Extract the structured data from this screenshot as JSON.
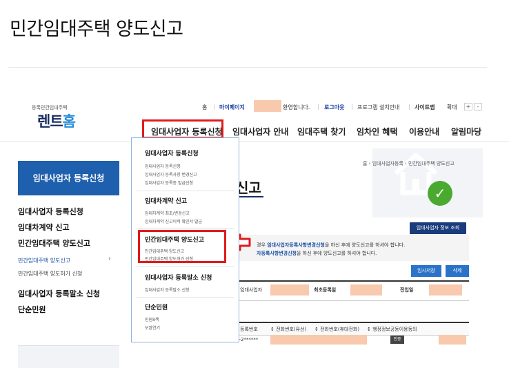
{
  "page": {
    "title": "민간임대주택 양도신고"
  },
  "header": {
    "logo_sub": "등록민간임대주택",
    "logo_main_a": "렌트",
    "logo_main_b": "홈",
    "util": {
      "home": "홈",
      "mypage": "마이페이지",
      "welcome": "환영합니다.",
      "logout": "로그아웃",
      "program": "프로그램 설치안내",
      "sitemap": "사이트맵",
      "zoom_label": "확대",
      "zoom_in": "+",
      "zoom_out": "-"
    },
    "nav": [
      "임대사업자 등록신청",
      "임대사업자 안내",
      "임대주택 찾기",
      "임차인 혜택",
      "이용안내",
      "알림마당"
    ]
  },
  "sidebar": {
    "heading": "임대사업자 등록신청",
    "items": [
      "임대사업자 등록신청",
      "임대차계약 신고",
      "민간임대주택 양도신고",
      "민간임대주택 양도신고",
      "민간임대주택 양도허가 신청",
      "임대사업자 등록말소 신청",
      "단순민원"
    ],
    "arrow": "›"
  },
  "content": {
    "breadcrumb": "홈 › 임대사업자등록 › 민간임대주택 양도신고",
    "title": "신고",
    "owner_info_button": "임대사업자 정보 조회",
    "notice": {
      "line1_a": "경우 ",
      "line1_link": "임대사업자등록사항변경신청",
      "line1_b": "을 하신 후에 양도신고를 하셔야 합니다.",
      "line2_link": "자등록사항변경신청",
      "line2_b": "을 하신 후에 양도신고를 하셔야 합니다."
    },
    "temp_save": "임시저장",
    "delete": "삭제",
    "info_labels": {
      "owner": "임대사업자",
      "first_reg": "최초등록일",
      "transfer": "전입일"
    },
    "table_headers": [
      "등록번호",
      "↕ 전화번호(유선)",
      "↕ 전화번호(휴대전화)",
      "↕ 행정정보공동이용동의"
    ],
    "row": {
      "reg_no": "9-2******",
      "auth": "인증"
    }
  },
  "dropdown": {
    "groups": [
      {
        "title": "임대사업자 등록신청",
        "subs": [
          "임대사업자 등록신청",
          "임대사업자 등록사항 변경신고",
          "임대사업자 등록증 발급신청"
        ]
      },
      {
        "title": "임대차계약 신고",
        "subs": [
          "임대차계약 최초/변경신고",
          "임대차계약 신고이력 확인서 발급"
        ]
      },
      {
        "title": "민간임대주택 양도신고",
        "subs": [
          "민간임대주택 양도신고",
          "민간임대주택 양도허가 신청"
        ]
      },
      {
        "title": "임대사업자 등록말소 신청",
        "subs": [
          "임대사업자 등록말소 신청"
        ]
      },
      {
        "title": "단순민원",
        "subs": [
          "민원8책",
          "보완연기"
        ]
      }
    ]
  },
  "colors": {
    "highlight": "#e11b1b",
    "primary": "#1e5fae",
    "navy": "#1a3c7c",
    "redacted": "#f8c9ad",
    "accent_green": "#4aa92f"
  }
}
